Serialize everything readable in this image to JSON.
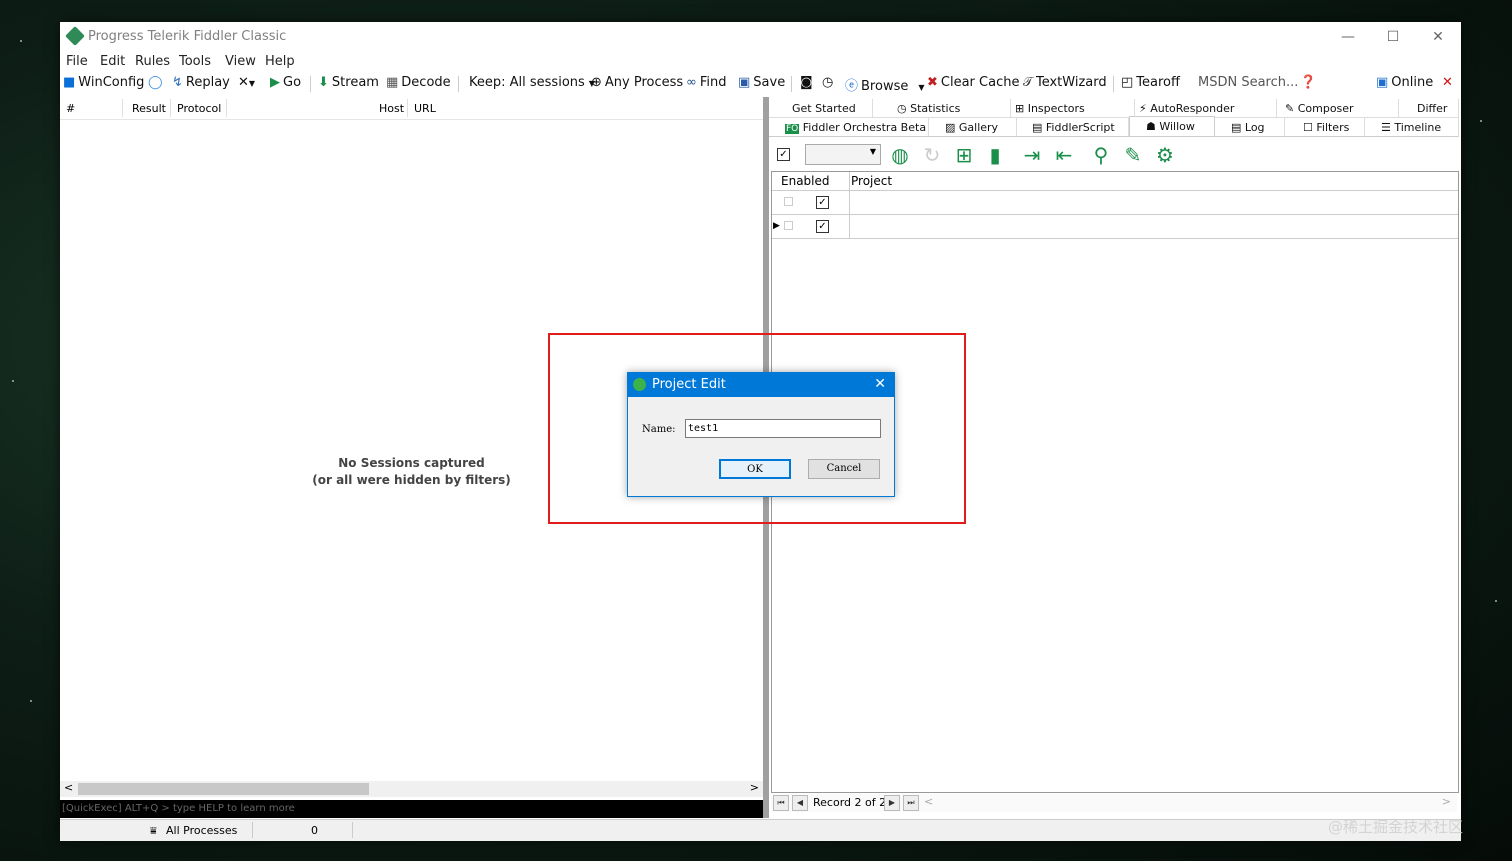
{
  "window": {
    "title": "Progress Telerik Fiddler Classic",
    "minimize": "—",
    "maximize": "☐",
    "close": "✕"
  },
  "menu": [
    "File",
    "Edit",
    "Rules",
    "Tools",
    "View",
    "Help"
  ],
  "toolbar": {
    "winconfig": "WinConfig",
    "replay": "Replay",
    "remove": "✕",
    "go": "Go",
    "stream": "Stream",
    "decode": "Decode",
    "keep": "Keep: All sessions",
    "any_process": "Any Process",
    "find": "Find",
    "save": "Save",
    "browse": "Browse",
    "clear_cache": "Clear Cache",
    "textwizard": "TextWizard",
    "tearoff": "Tearoff",
    "msdn_search": "MSDN Search...",
    "online": "Online"
  },
  "sessions": {
    "columns": [
      "#",
      "Result",
      "Protocol",
      "Host",
      "URL"
    ],
    "empty_line1": "No Sessions captured",
    "empty_line2": "(or all were hidden by filters)",
    "quickexec_placeholder": "[QuickExec] ALT+Q > type HELP to learn more"
  },
  "tabs_row1": [
    "Get Started",
    "Statistics",
    "Inspectors",
    "AutoResponder",
    "Composer",
    "Differ"
  ],
  "tabs_row2": [
    "Fiddler Orchestra Beta",
    "Gallery",
    "FiddlerScript",
    "Willow",
    "Log",
    "Filters",
    "Timeline"
  ],
  "active_tab": "Willow",
  "willow": {
    "columns": [
      "Enabled",
      "Project"
    ],
    "rows": [
      {
        "enabled": true,
        "project": ""
      },
      {
        "enabled": true,
        "project": ""
      }
    ],
    "record_label": "Record 2 of 2"
  },
  "statusbar": {
    "processes": "All Processes",
    "count": "0"
  },
  "dialog": {
    "title": "Project Edit",
    "name_label": "Name:",
    "name_value": "test1",
    "ok": "OK",
    "cancel": "Cancel"
  },
  "watermark": "@稀土掘金技术社区",
  "colors": {
    "accent": "#0078d7",
    "highlight_box": "#e21b1b",
    "willow_icon": "#1a8f4a"
  }
}
